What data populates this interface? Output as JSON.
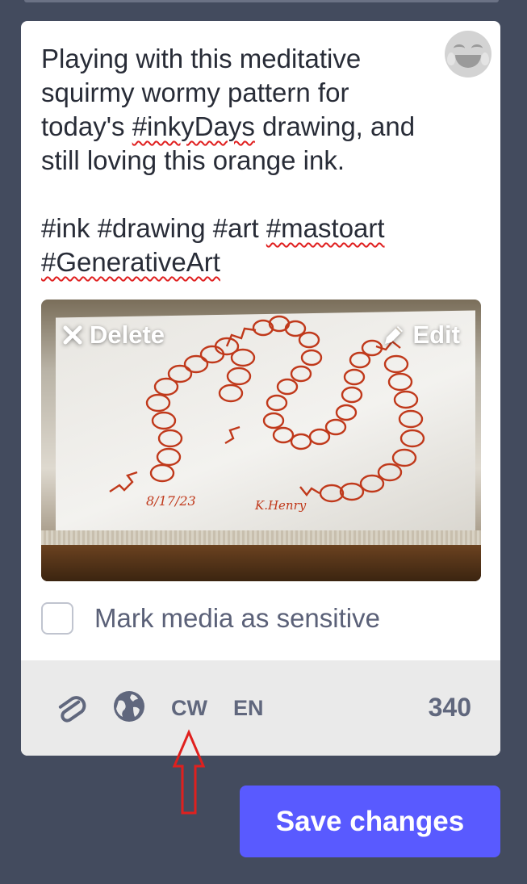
{
  "compose": {
    "text_line1": "Playing with this meditative",
    "text_line2": "squirmy wormy pattern for",
    "text_line3_pre": "today's ",
    "text_line3_tag": "#inkyDays",
    "text_line3_post": " drawing, and",
    "text_line4": "still loving this orange ink.",
    "tags_line1_pre": "#ink #drawing #art ",
    "tags_line1_tag": "#mastoart",
    "tags_line2_tag": "#GenerativeArt",
    "emoji_icon": "joy-emoji-icon"
  },
  "media": {
    "delete_label": "Delete",
    "edit_label": "Edit",
    "date_handwriting": "8/17/23",
    "signature": "K.Henry"
  },
  "sensitive": {
    "label": "Mark media as sensitive",
    "checked": false
  },
  "toolbar": {
    "attach_icon": "paperclip-icon",
    "visibility_icon": "globe-icon",
    "cw_label": "CW",
    "language_label": "EN",
    "char_count": "340"
  },
  "actions": {
    "save_label": "Save changes"
  },
  "colors": {
    "background": "#434b5e",
    "accent": "#595aff",
    "toolbar_bg": "#eaeaea",
    "annotation": "#e0201e"
  }
}
